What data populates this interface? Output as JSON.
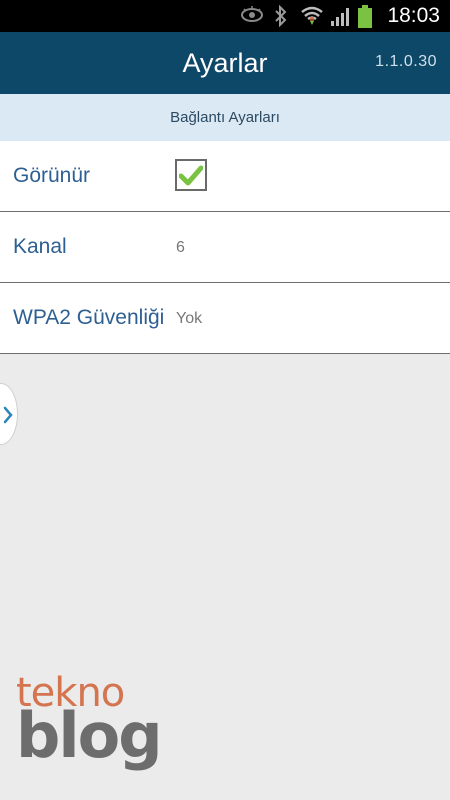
{
  "status_bar": {
    "time": "18:03",
    "icons": [
      "eye-icon",
      "bluetooth-icon",
      "wifi-icon",
      "signal-icon",
      "battery-icon"
    ]
  },
  "app_bar": {
    "title": "Ayarlar",
    "version": "1.1.0.30"
  },
  "section": {
    "title": "Bağlantı Ayarları"
  },
  "settings": {
    "visible": {
      "label": "Görünür",
      "checked": true
    },
    "channel": {
      "label": "Kanal",
      "value": "6"
    },
    "wpa2": {
      "label": "WPA2 Güvenliği",
      "value": "Yok"
    }
  },
  "watermark": {
    "line1": "tekno",
    "line2": "blog"
  },
  "colors": {
    "app_bar": "#0e4868",
    "section_bg": "#dbe9f4",
    "label": "#2e5f93",
    "check": "#7bc242",
    "watermark_orange": "#d4754f"
  }
}
